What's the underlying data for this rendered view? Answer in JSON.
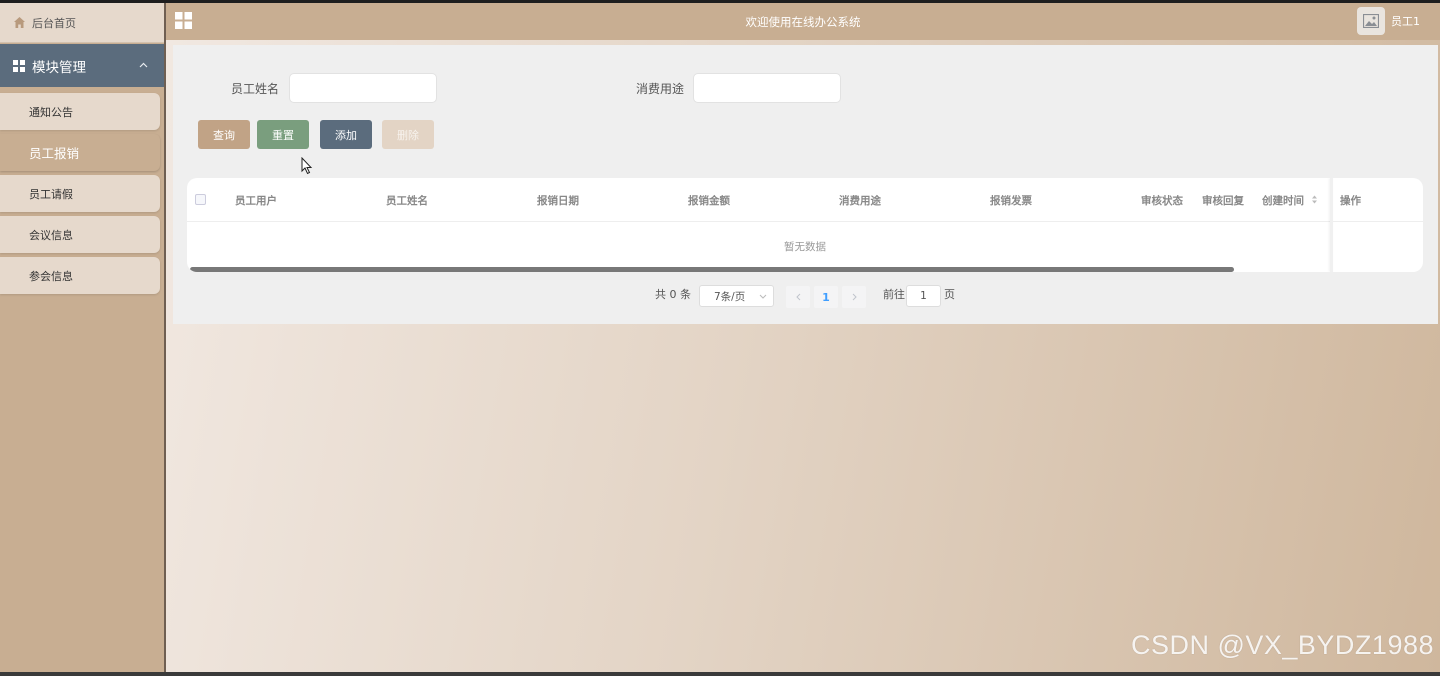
{
  "header": {
    "title": "欢迎使用在线办公系统",
    "user_name": "员工1"
  },
  "sidebar": {
    "home_label": "后台首页",
    "module_label": "模块管理",
    "items": [
      {
        "label": "通知公告"
      },
      {
        "label": "员工报销"
      },
      {
        "label": "员工请假"
      },
      {
        "label": "会议信息"
      },
      {
        "label": "参会信息"
      }
    ],
    "active_index": 1
  },
  "search": {
    "name_label": "员工姓名",
    "name_value": "",
    "purpose_label": "消费用途",
    "purpose_value": ""
  },
  "actions": {
    "query": "查询",
    "reset": "重置",
    "add": "添加",
    "delete": "删除"
  },
  "table": {
    "columns": [
      "员工用户",
      "员工姓名",
      "报销日期",
      "报销金额",
      "消费用途",
      "报销发票",
      "审核状态",
      "审核回复",
      "创建时间",
      "操作"
    ],
    "empty_text": "暂无数据"
  },
  "pagination": {
    "total_text": "共 0 条",
    "page_size": "7条/页",
    "current_page": "1",
    "goto_prefix": "前往",
    "goto_value": "1",
    "goto_suffix": "页"
  },
  "watermark": "CSDN @VX_BYDZ1988",
  "colors": {
    "sidebar": "#c8ae92",
    "module_header": "#5b6c7d",
    "btn_query": "#c1a386",
    "btn_reset": "#7a9e7e",
    "btn_add": "#5b6c7d",
    "btn_delete": "#e3d4c5"
  }
}
